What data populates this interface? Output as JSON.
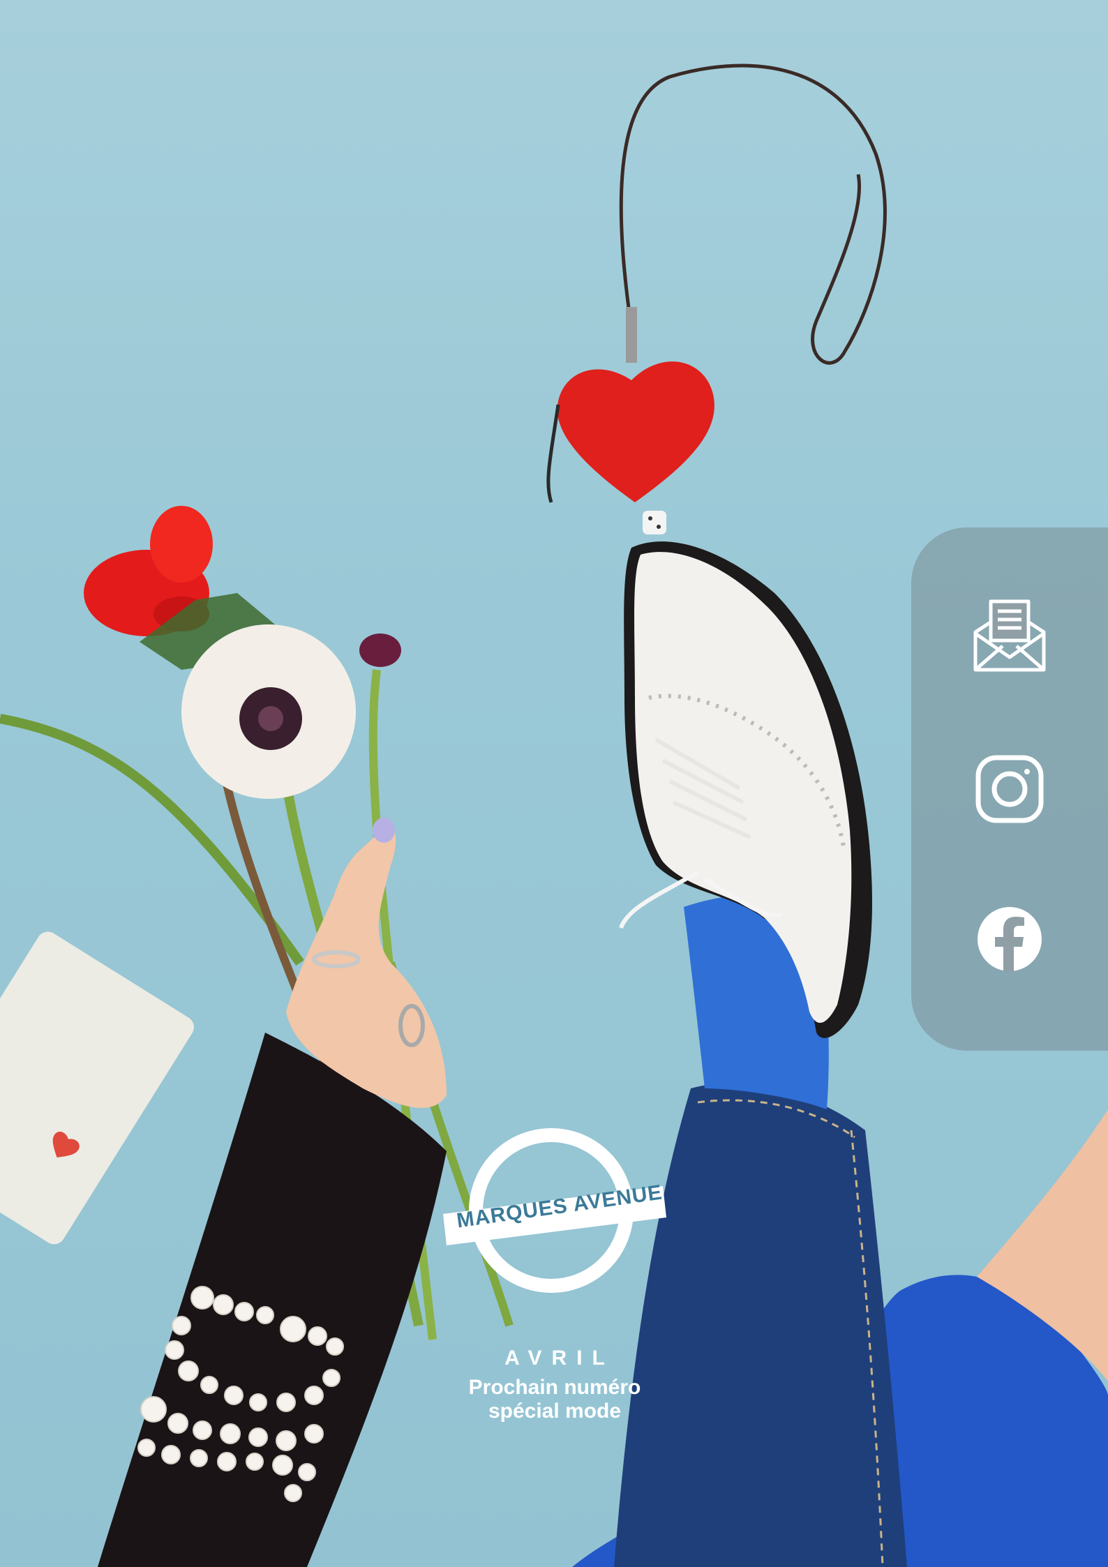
{
  "social": {
    "items": [
      {
        "name": "newsletter",
        "icon": "envelope-newsletter-icon"
      },
      {
        "name": "instagram",
        "icon": "instagram-icon"
      },
      {
        "name": "facebook",
        "icon": "facebook-icon"
      }
    ]
  },
  "brand": {
    "name": "MARQUES AVENUE"
  },
  "announcement": {
    "month": "AVRIL",
    "line1": "Prochain numéro",
    "line2": "spécial mode"
  },
  "colors": {
    "background": "#9ac8d6",
    "panel": "#7e9096",
    "heart": "#e0201c",
    "sock": "#2f6fd6",
    "jeans": "#1f3f7a",
    "white": "#ffffff"
  }
}
